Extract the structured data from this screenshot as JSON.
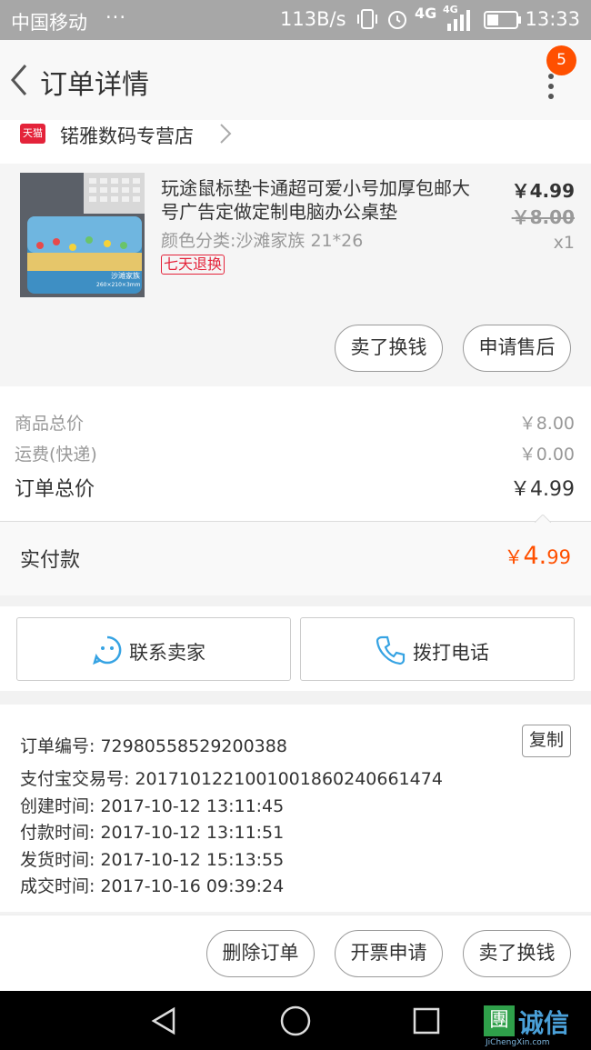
{
  "status_bar": {
    "carrier": "中国移动",
    "dots": "···",
    "net_speed": "113B/s",
    "network": "4G",
    "network2": "4G",
    "time": "13:33"
  },
  "header": {
    "title": "订单详情",
    "badge": "5"
  },
  "shop": {
    "logo_text": "天猫",
    "name": "锘雅数码专营店"
  },
  "product": {
    "title": "玩途鼠标垫卡通超可爱小号加厚包邮大号广告定做定制电脑办公桌垫",
    "spec": "颜色分类:沙滩家族 21*26",
    "return_tag": "七天退换",
    "price": "￥4.99",
    "original_price": "￥8.00",
    "quantity": "x1",
    "thumb_caption": "沙滩家族",
    "thumb_size": "260×210×3mm",
    "buttons": [
      "卖了换钱",
      "申请售后"
    ]
  },
  "totals": {
    "goods_label": "商品总价",
    "goods_value": "￥8.00",
    "shipping_label": "运费(快递)",
    "shipping_value": "￥0.00",
    "order_label": "订单总价",
    "order_value": "￥4.99",
    "paid_label": "实付款",
    "paid_currency": "￥",
    "paid_int": "4.",
    "paid_dec": "99"
  },
  "contact": {
    "seller_label": "联系卖家",
    "phone_label": "拨打电话"
  },
  "order_info": {
    "copy_label": "复制",
    "rows": [
      "订单编号: 72980558529200388",
      "支付宝交易号: 2017101221001001860240661474",
      "创建时间: 2017-10-12 13:11:45",
      "付款时间: 2017-10-12 13:11:51",
      "发货时间: 2017-10-12 15:13:55",
      "成交时间: 2017-10-16 09:39:24"
    ]
  },
  "bottom_actions": [
    "删除订单",
    "开票申请",
    "卖了换钱"
  ],
  "watermark": {
    "text": "诚信",
    "box": "團",
    "sub": "JiChengXin.com"
  },
  "colors": {
    "accent": "#ff5000",
    "tmall_red": "#e4233a",
    "icon_blue": "#36a3e3"
  }
}
